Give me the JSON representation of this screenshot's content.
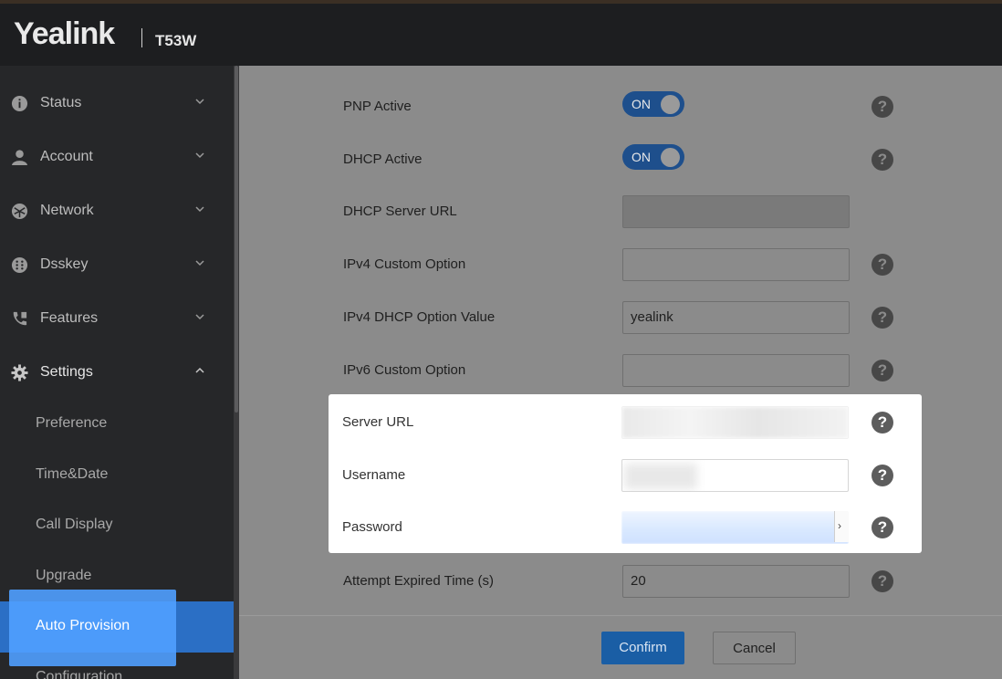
{
  "header": {
    "brand": "Yealink",
    "model": "T53W"
  },
  "sidebar": {
    "menu": [
      {
        "label": "Status",
        "icon": "info-icon"
      },
      {
        "label": "Account",
        "icon": "user-icon"
      },
      {
        "label": "Network",
        "icon": "network-icon"
      },
      {
        "label": "Dsskey",
        "icon": "keypad-icon"
      },
      {
        "label": "Features",
        "icon": "phone-icon"
      },
      {
        "label": "Settings",
        "icon": "gear-icon"
      }
    ],
    "settings_submenu": [
      {
        "label": "Preference"
      },
      {
        "label": "Time&Date"
      },
      {
        "label": "Call Display"
      },
      {
        "label": "Upgrade"
      },
      {
        "label": "Auto Provision"
      },
      {
        "label": "Configuration"
      }
    ]
  },
  "form": {
    "pnp_active": {
      "label": "PNP Active",
      "value": "ON"
    },
    "dhcp_active": {
      "label": "DHCP Active",
      "value": "ON"
    },
    "dhcp_server_url": {
      "label": "DHCP Server URL",
      "value": ""
    },
    "ipv4_custom_option": {
      "label": "IPv4 Custom Option",
      "value": ""
    },
    "ipv4_dhcp_option_value": {
      "label": "IPv4 DHCP Option Value",
      "value": "yealink"
    },
    "ipv6_custom_option": {
      "label": "IPv6 Custom Option",
      "value": ""
    },
    "server_url": {
      "label": "Server URL",
      "value": ""
    },
    "username": {
      "label": "Username",
      "value": ""
    },
    "password": {
      "label": "Password",
      "value": ""
    },
    "attempt_expired_time": {
      "label": "Attempt Expired Time (s)",
      "value": "20"
    }
  },
  "help_glyph": "?",
  "buttons": {
    "confirm": "Confirm",
    "cancel": "Cancel"
  },
  "colors": {
    "accent": "#2b6fc5",
    "confirm": "#1a5ea5",
    "active_highlight": "#50a0ff"
  }
}
